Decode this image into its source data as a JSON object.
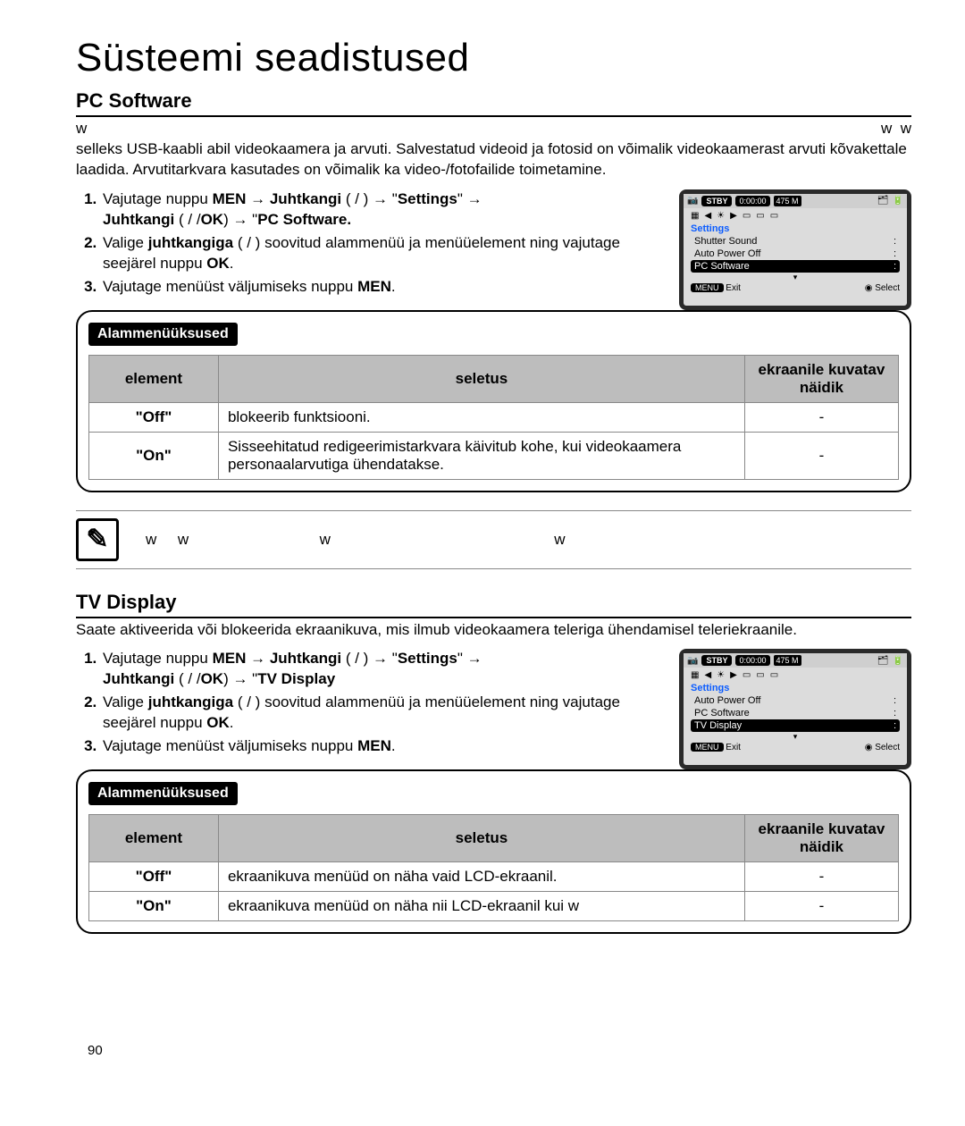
{
  "title": "Süsteemi seadistused",
  "page_number": "90",
  "section_pc": {
    "heading": "PC Software",
    "intro_pre": "w",
    "intro_mid_ws": "w  w",
    "intro": "selleks USB-kaabli abil videokaamera ja arvuti. Salvestatud videoid ja fotosid on võimalik videokaamerast arvuti kõvakettale laadida. Arvutitarkvara kasutades on võimalik ka video-/fotofailide toimetamine.",
    "step1_a": "Vajutage nuppu ",
    "step1_b": "MEN",
    "step1_c": " → ",
    "step1_d": "Juhtkangi",
    "step1_e": " ( / ) → \"",
    "step1_f": "Settings",
    "step1_g": "\" → ",
    "step1_line2a": "Juhtkangi",
    "step1_line2b": " ( / /",
    "step1_line2c": "OK",
    "step1_line2d": ") → \"",
    "step1_line2e": "PC Software.",
    "step2_a": "Valige ",
    "step2_b": "juhtkangiga",
    "step2_c": " ( / ) soovitud alammenüü ja menüüelement ning vajutage seejärel nuppu ",
    "step2_d": "OK",
    "step2_e": ".",
    "step3_a": "Vajutage menüüst väljumiseks nuppu ",
    "step3_b": "MEN",
    "step3_c": "."
  },
  "osd1": {
    "stby": "STBY",
    "time": "0:00:00",
    "mem": "475 M",
    "settings": "Settings",
    "rows": [
      {
        "label": "Shutter Sound",
        "val": ":"
      },
      {
        "label": "Auto Power Off",
        "val": ":"
      },
      {
        "label": "PC Software",
        "val": ":"
      }
    ],
    "menu": "MENU",
    "exit": "Exit",
    "select": "Select"
  },
  "sub_label": "Alammenüüksused",
  "sub_headers": {
    "el": "element",
    "desc": "seletus",
    "ind": "ekraanile kuvatav näidik"
  },
  "sub_pc_rows": [
    {
      "el": "\"Off\"",
      "desc": "blokeerib funktsiooni.",
      "ind": "-"
    },
    {
      "el": "\"On\"",
      "desc": "Sisseehitatud redigeerimistarkvara käivitub kohe, kui videokaamera personaalarvutiga ühendatakse.",
      "ind": "-"
    }
  ],
  "note1": "w     w                               w                                                     w",
  "section_tv": {
    "heading": "TV Display",
    "intro": "Saate aktiveerida või blokeerida ekraanikuva, mis ilmub videokaamera teleriga ühendamisel teleriekraanile.",
    "step1_a": "Vajutage nuppu ",
    "step1_b": "MEN",
    "step1_c": " → ",
    "step1_d": "Juhtkangi",
    "step1_e": " ( / ) → \"",
    "step1_f": "Settings",
    "step1_g": "\" → ",
    "step1_line2a": "Juhtkangi",
    "step1_line2b": " ( / /",
    "step1_line2c": "OK",
    "step1_line2d": ") → \"",
    "step1_line2e": "TV Display",
    "step2_a": "Valige ",
    "step2_b": "juhtkangiga",
    "step2_c": " ( / ) soovitud alammenüü ja menüüelement ning vajutage seejärel nuppu ",
    "step2_d": "OK",
    "step2_e": ".",
    "step3_a": "Vajutage menüüst väljumiseks nuppu ",
    "step3_b": "MEN",
    "step3_c": "."
  },
  "osd2": {
    "stby": "STBY",
    "time": "0:00:00",
    "mem": "475 M",
    "settings": "Settings",
    "rows": [
      {
        "label": "Auto Power Off",
        "val": ":"
      },
      {
        "label": "PC Software",
        "val": ":"
      },
      {
        "label": "TV Display",
        "val": ":"
      }
    ],
    "menu": "MENU",
    "exit": "Exit",
    "select": "Select"
  },
  "sub_tv_rows": [
    {
      "el": "\"Off\"",
      "desc": "ekraanikuva menüüd on näha vaid LCD-ekraanil.",
      "ind": "-"
    },
    {
      "el": "\"On\"",
      "desc": "ekraanikuva menüüd on näha nii LCD-ekraanil kui w",
      "ind": "-"
    }
  ]
}
